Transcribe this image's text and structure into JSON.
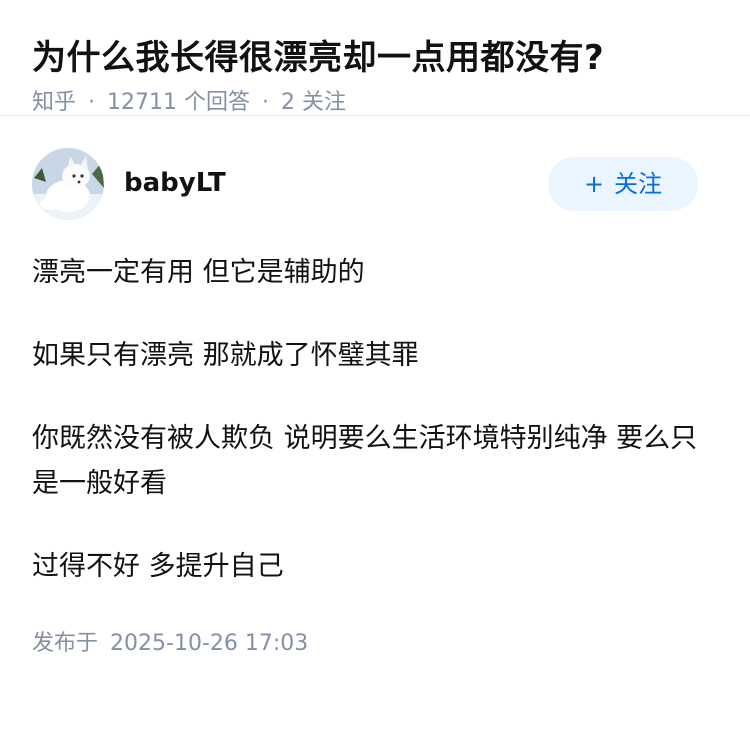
{
  "question": {
    "title": "为什么我长得很漂亮却一点用都没有?",
    "source": "知乎",
    "answer_count": "12711",
    "answer_unit": "个回答",
    "follower_count": "2",
    "follower_unit": "关注"
  },
  "answer": {
    "author_name": "babyLT",
    "follow_button": {
      "icon": "+",
      "label": "关注"
    },
    "paragraphs": [
      "漂亮一定有用 但它是辅助的",
      "如果只有漂亮 那就成了怀璧其罪",
      "你既然没有被人欺负 说明要么生活环境特别纯净 要么只是一般好看",
      "过得不好 多提升自己"
    ],
    "published_label": "发布于",
    "published_time": "2025-10-26 17:03"
  },
  "colors": {
    "accent": "#056de8",
    "accent_bg": "#ebf5ff",
    "meta_gray": "#8590a6",
    "text": "#121212"
  }
}
